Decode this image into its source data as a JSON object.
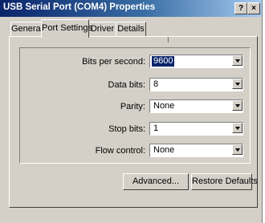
{
  "window": {
    "title": "USB Serial Port (COM4) Properties",
    "help_button": "?",
    "close_button": "×"
  },
  "tabs": [
    {
      "label": "General",
      "selected": false
    },
    {
      "label": "Port Settings",
      "selected": true
    },
    {
      "label": "Driver",
      "selected": false
    },
    {
      "label": "Details",
      "selected": false
    }
  ],
  "settings": {
    "bits_per_second": {
      "label": "Bits per second:",
      "value": "9600"
    },
    "data_bits": {
      "label": "Data bits:",
      "value": "8"
    },
    "parity": {
      "label": "Parity:",
      "value": "None"
    },
    "stop_bits": {
      "label": "Stop bits:",
      "value": "1"
    },
    "flow_control": {
      "label": "Flow control:",
      "value": "None"
    }
  },
  "buttons": {
    "advanced": "Advanced...",
    "restore_defaults": "Restore Defaults"
  },
  "icons": {
    "dropdown": "chevron-down-icon",
    "close": "close-icon",
    "help": "help-icon"
  },
  "colors": {
    "titlebar_start": "#0a246a",
    "titlebar_end": "#a6caf0",
    "dialog_face": "#d4d0c8",
    "selection": "#0a246a"
  }
}
